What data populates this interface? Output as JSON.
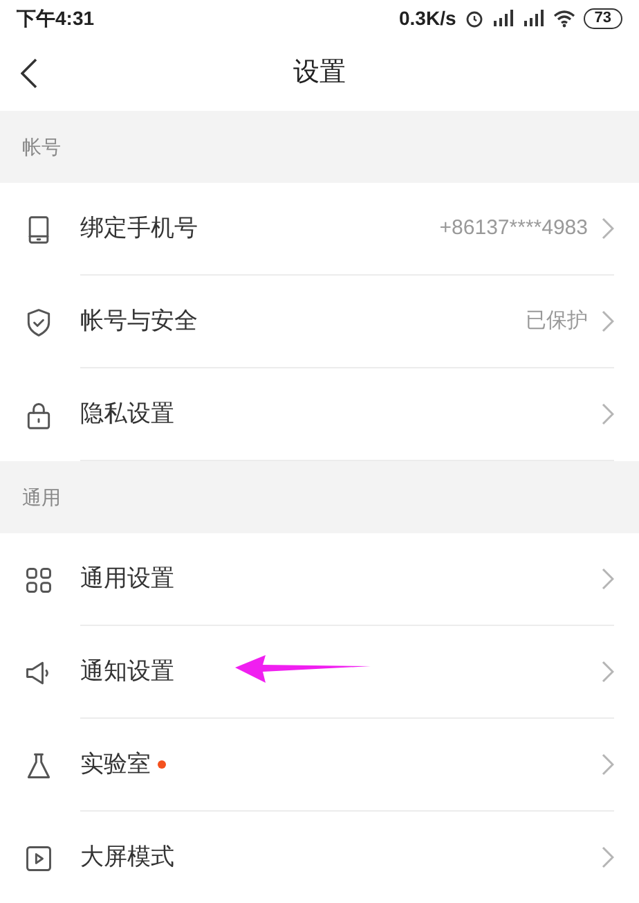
{
  "status_bar": {
    "time": "下午4:31",
    "speed": "0.3K/s",
    "battery": "73"
  },
  "header": {
    "title": "设置"
  },
  "sections": [
    {
      "title": "帐号",
      "items": [
        {
          "label": "绑定手机号",
          "value": "+86137****4983"
        },
        {
          "label": "帐号与安全",
          "value": "已保护"
        },
        {
          "label": "隐私设置"
        }
      ]
    },
    {
      "title": "通用",
      "items": [
        {
          "label": "通用设置"
        },
        {
          "label": "通知设置"
        },
        {
          "label": "实验室",
          "color": "#f4511e"
        },
        {
          "label": "大屏模式"
        }
      ]
    }
  ]
}
